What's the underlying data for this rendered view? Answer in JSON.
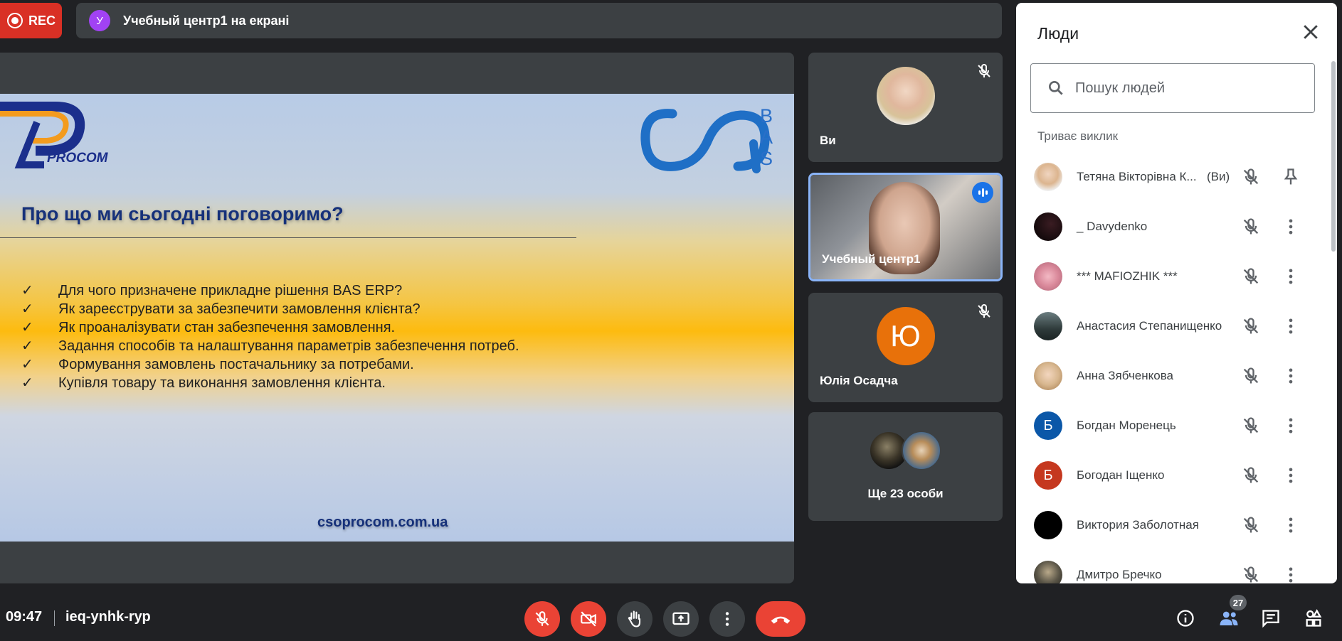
{
  "recording": {
    "label": "REC"
  },
  "presenter_bar": {
    "avatar_letter": "У",
    "text": "Учебный центр1 на екрані"
  },
  "slide": {
    "logo_left_text": "PROCOM",
    "logo_right_letters": [
      "B",
      "A",
      "S"
    ],
    "title": "Про що ми сьогодні поговоримо?",
    "items": [
      "Для чого призначене прикладне рішення BAS ERP?",
      "Як зареєструвати за забезпечити замовлення клієнта?",
      "Як проаналізувати стан забезпечення замовлення.",
      "Задання способів та налаштування параметрів забезпечення потреб.",
      "Формування замовлень постачальнику за потребами.",
      "Купівля товару та виконання замовлення клієнта."
    ],
    "check_mark": "✓",
    "url": "csoprocom.com.ua"
  },
  "tiles": {
    "you": {
      "name": "Ви"
    },
    "speaker": {
      "name": "Учебный центр1"
    },
    "yulia": {
      "name": "Юлія Осадча",
      "letter": "Ю",
      "color": "#e8710a"
    },
    "more": {
      "text": "Ще 23 особи"
    }
  },
  "people_panel": {
    "title": "Люди",
    "search_placeholder": "Пошук людей",
    "section_label": "Триває виклик",
    "people": [
      {
        "name": "Тетяна Вікторівна К...",
        "you_label": "(Ви)",
        "avatar_type": "photo",
        "avatar_color": "#e7c9a9",
        "action": "pin-icon"
      },
      {
        "name": "_ Davydenko",
        "avatar_type": "photo",
        "avatar_color": "#1a0f12",
        "action": "more-vert-icon"
      },
      {
        "name": "*** MAFIOZHIK ***",
        "avatar_type": "photo",
        "avatar_color": "#d9889a",
        "action": "more-vert-icon"
      },
      {
        "name": "Анастасия Степанищенко",
        "avatar_type": "photo",
        "avatar_color": "#3b4a4a",
        "action": "more-vert-icon"
      },
      {
        "name": "Анна Зябченкова",
        "avatar_type": "photo",
        "avatar_color": "#d7b68e",
        "action": "more-vert-icon"
      },
      {
        "name": "Богдан Моренець",
        "avatar_type": "letter",
        "letter": "Б",
        "avatar_color": "#0b57a8",
        "action": "more-vert-icon"
      },
      {
        "name": "Богодан Іщенко",
        "avatar_type": "letter",
        "letter": "Б",
        "avatar_color": "#c5381f",
        "action": "more-vert-icon"
      },
      {
        "name": "Виктория Заболотная",
        "avatar_type": "photo",
        "avatar_color": "#000000",
        "action": "more-vert-icon"
      },
      {
        "name": "Дмитро Бречко",
        "avatar_type": "photo",
        "avatar_color": "#5b5648",
        "action": "more-vert-icon"
      }
    ]
  },
  "bottom_bar": {
    "time": "09:47",
    "meeting_code": "ieq-ynhk-rур",
    "people_count": "27",
    "controls": [
      "mic-off-icon",
      "camera-off-icon",
      "raise-hand-icon",
      "present-icon",
      "more-vert-icon",
      "end-call-icon"
    ],
    "right_icons": [
      "info-icon",
      "people-icon",
      "chat-icon",
      "activities-icon"
    ]
  },
  "colors": {
    "background": "#202124",
    "tile": "#3c4043",
    "danger": "#ea4335",
    "accent": "#1a73e8"
  }
}
